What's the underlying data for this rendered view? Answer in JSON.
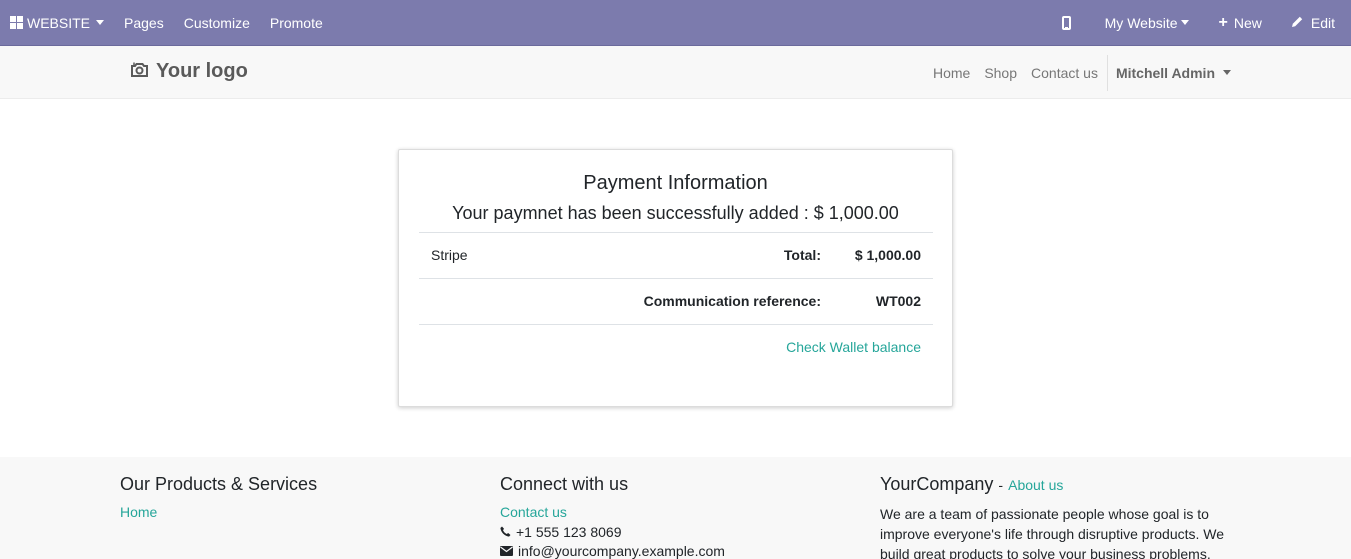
{
  "admin_bar": {
    "apps_label": "WEBSITE",
    "menu": [
      "Pages",
      "Customize",
      "Promote"
    ],
    "website_selector": "My Website",
    "new_label": "New",
    "edit_label": "Edit"
  },
  "header": {
    "logo_text": "Your logo",
    "nav": [
      "Home",
      "Shop",
      "Contact us"
    ],
    "user": "Mitchell Admin"
  },
  "payment": {
    "title": "Payment Information",
    "subtitle": "Your paymnet has been successfully added : $ 1,000.00",
    "provider": "Stripe",
    "total_label": "Total:",
    "total_value": "$ 1,000.00",
    "reference_label": "Communication reference:",
    "reference_value": "WT002",
    "check_wallet": "Check Wallet balance"
  },
  "footer": {
    "col1": {
      "title": "Our Products & Services",
      "link": "Home"
    },
    "col2": {
      "title": "Connect with us",
      "link": "Contact us",
      "phone": "+1 555 123 8069",
      "email": "info@yourcompany.example.com"
    },
    "col3": {
      "title": "YourCompany",
      "separator": "-",
      "about": "About us",
      "text": "We are a team of passionate people whose goal is to improve everyone's life through disruptive products. We build great products to solve your business problems."
    }
  },
  "colors": {
    "admin_bar": "#7c7bad",
    "link": "#26a69a"
  },
  "icons": {
    "apps": "grid-icon",
    "mobile": "mobile-icon",
    "new": "plus-icon",
    "edit": "pencil-icon",
    "logo": "camera-icon",
    "phone": "phone-icon",
    "email": "envelope-icon"
  }
}
